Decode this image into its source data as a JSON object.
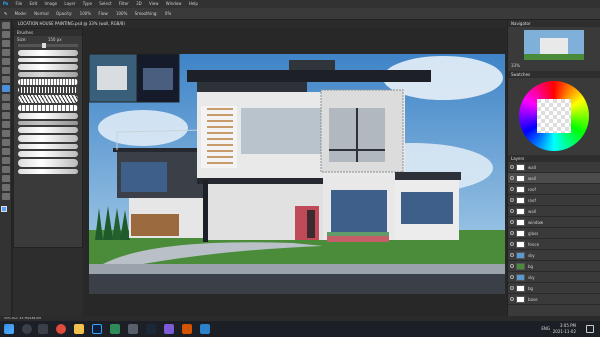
{
  "menu": {
    "items": [
      "File",
      "Edit",
      "Image",
      "Layer",
      "Type",
      "Select",
      "Filter",
      "3D",
      "View",
      "Window",
      "Help"
    ]
  },
  "options_bar": {
    "items": [
      "Mode:",
      "Normal",
      "Opacity:",
      "100%",
      "Flow:",
      "100%",
      "Smoothing:",
      "0%"
    ]
  },
  "document": {
    "tab_title": "LOCATION HOUSE PAINTING.psd @ 33% (wall, RGB/8)"
  },
  "brush_panel": {
    "title": "Brushes",
    "size_label": "Size:",
    "size_value": "150 px"
  },
  "navigator": {
    "title": "Navigator",
    "zoom": "33%"
  },
  "swatches": {
    "title": "Swatches"
  },
  "layers": {
    "title": "Layers",
    "items": [
      "wall",
      "wall",
      "roof",
      "roof",
      "wall",
      "window",
      "glass",
      "fence",
      "sky",
      "bg",
      "sky",
      "bg",
      "base"
    ]
  },
  "status": {
    "text": "33%    Doc: 23.7M/184.0M"
  },
  "taskbar": {
    "lang": "ENG",
    "time": "3:05 PM",
    "date": "2021-11-02"
  },
  "colors": {
    "accent": "#4a90d9",
    "panel": "#3a3a3a",
    "sky": "#5b9ad1",
    "grass": "#4a8c3a"
  }
}
